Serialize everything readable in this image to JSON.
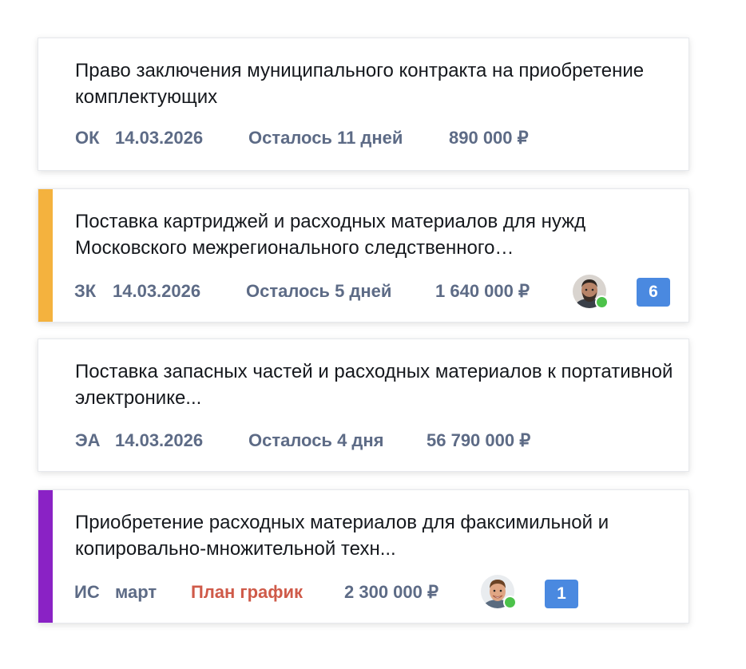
{
  "accent_colors": {
    "orange": "#f4b23e",
    "purple": "#8a22c5",
    "meta": "#5d6b86",
    "danger": "#cf5a49",
    "badge": "#4a89e0",
    "online": "#4cc24a"
  },
  "cards": [
    {
      "title": "Право заключения муниципального контракта на приобретение комплектующих",
      "type": "ОК",
      "date": "14.03.2026",
      "status": "Осталось 11 дней",
      "price": "890 000 ₽"
    },
    {
      "title": "Поставка картриджей и расходных материалов для нужд Московского межрегионального следственного…",
      "type": "ЗК",
      "date": "14.03.2026",
      "status": "Осталось 5 дней",
      "price": "1 640 000 ₽",
      "avatar_icon": "user-avatar-bearded",
      "badge": "6"
    },
    {
      "title": "Поставка запасных частей и расходных материалов к портативной электронике...",
      "type": "ЭА",
      "date": "14.03.2026",
      "status": "Осталось 4 дня",
      "price": "56 790 000 ₽"
    },
    {
      "title": "Приобретение расходных материалов для факсимильной и копировально-множительной техн...",
      "type": "ИС",
      "date": "март",
      "status": "План график",
      "price": "2 300 000 ₽",
      "avatar_icon": "user-avatar-smiling",
      "badge": "1"
    }
  ]
}
